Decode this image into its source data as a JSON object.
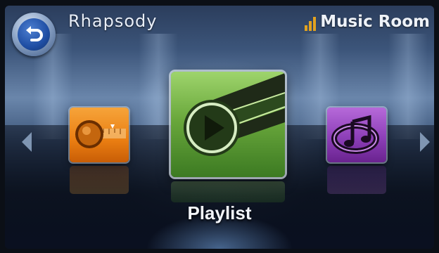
{
  "header": {
    "title": "Rhapsody",
    "room": "Music Room"
  },
  "icons": {
    "back": "back-arrow-icon",
    "signal": "signal-strength-icon",
    "left_arrow": "arrow-left-icon",
    "right_arrow": "arrow-right-icon"
  },
  "carousel": {
    "items": [
      {
        "icon": "radio-dial-icon",
        "color": "#ea7e12"
      },
      {
        "icon": "play-icon",
        "label": "Playlist",
        "color": "#6aa83c"
      },
      {
        "icon": "music-note-icon",
        "color": "#8d3fb8"
      }
    ],
    "selected_index": 1,
    "selected_label": "Playlist"
  },
  "colors": {
    "signal": "#e2a21f",
    "back_button": "#1f4ea4"
  }
}
